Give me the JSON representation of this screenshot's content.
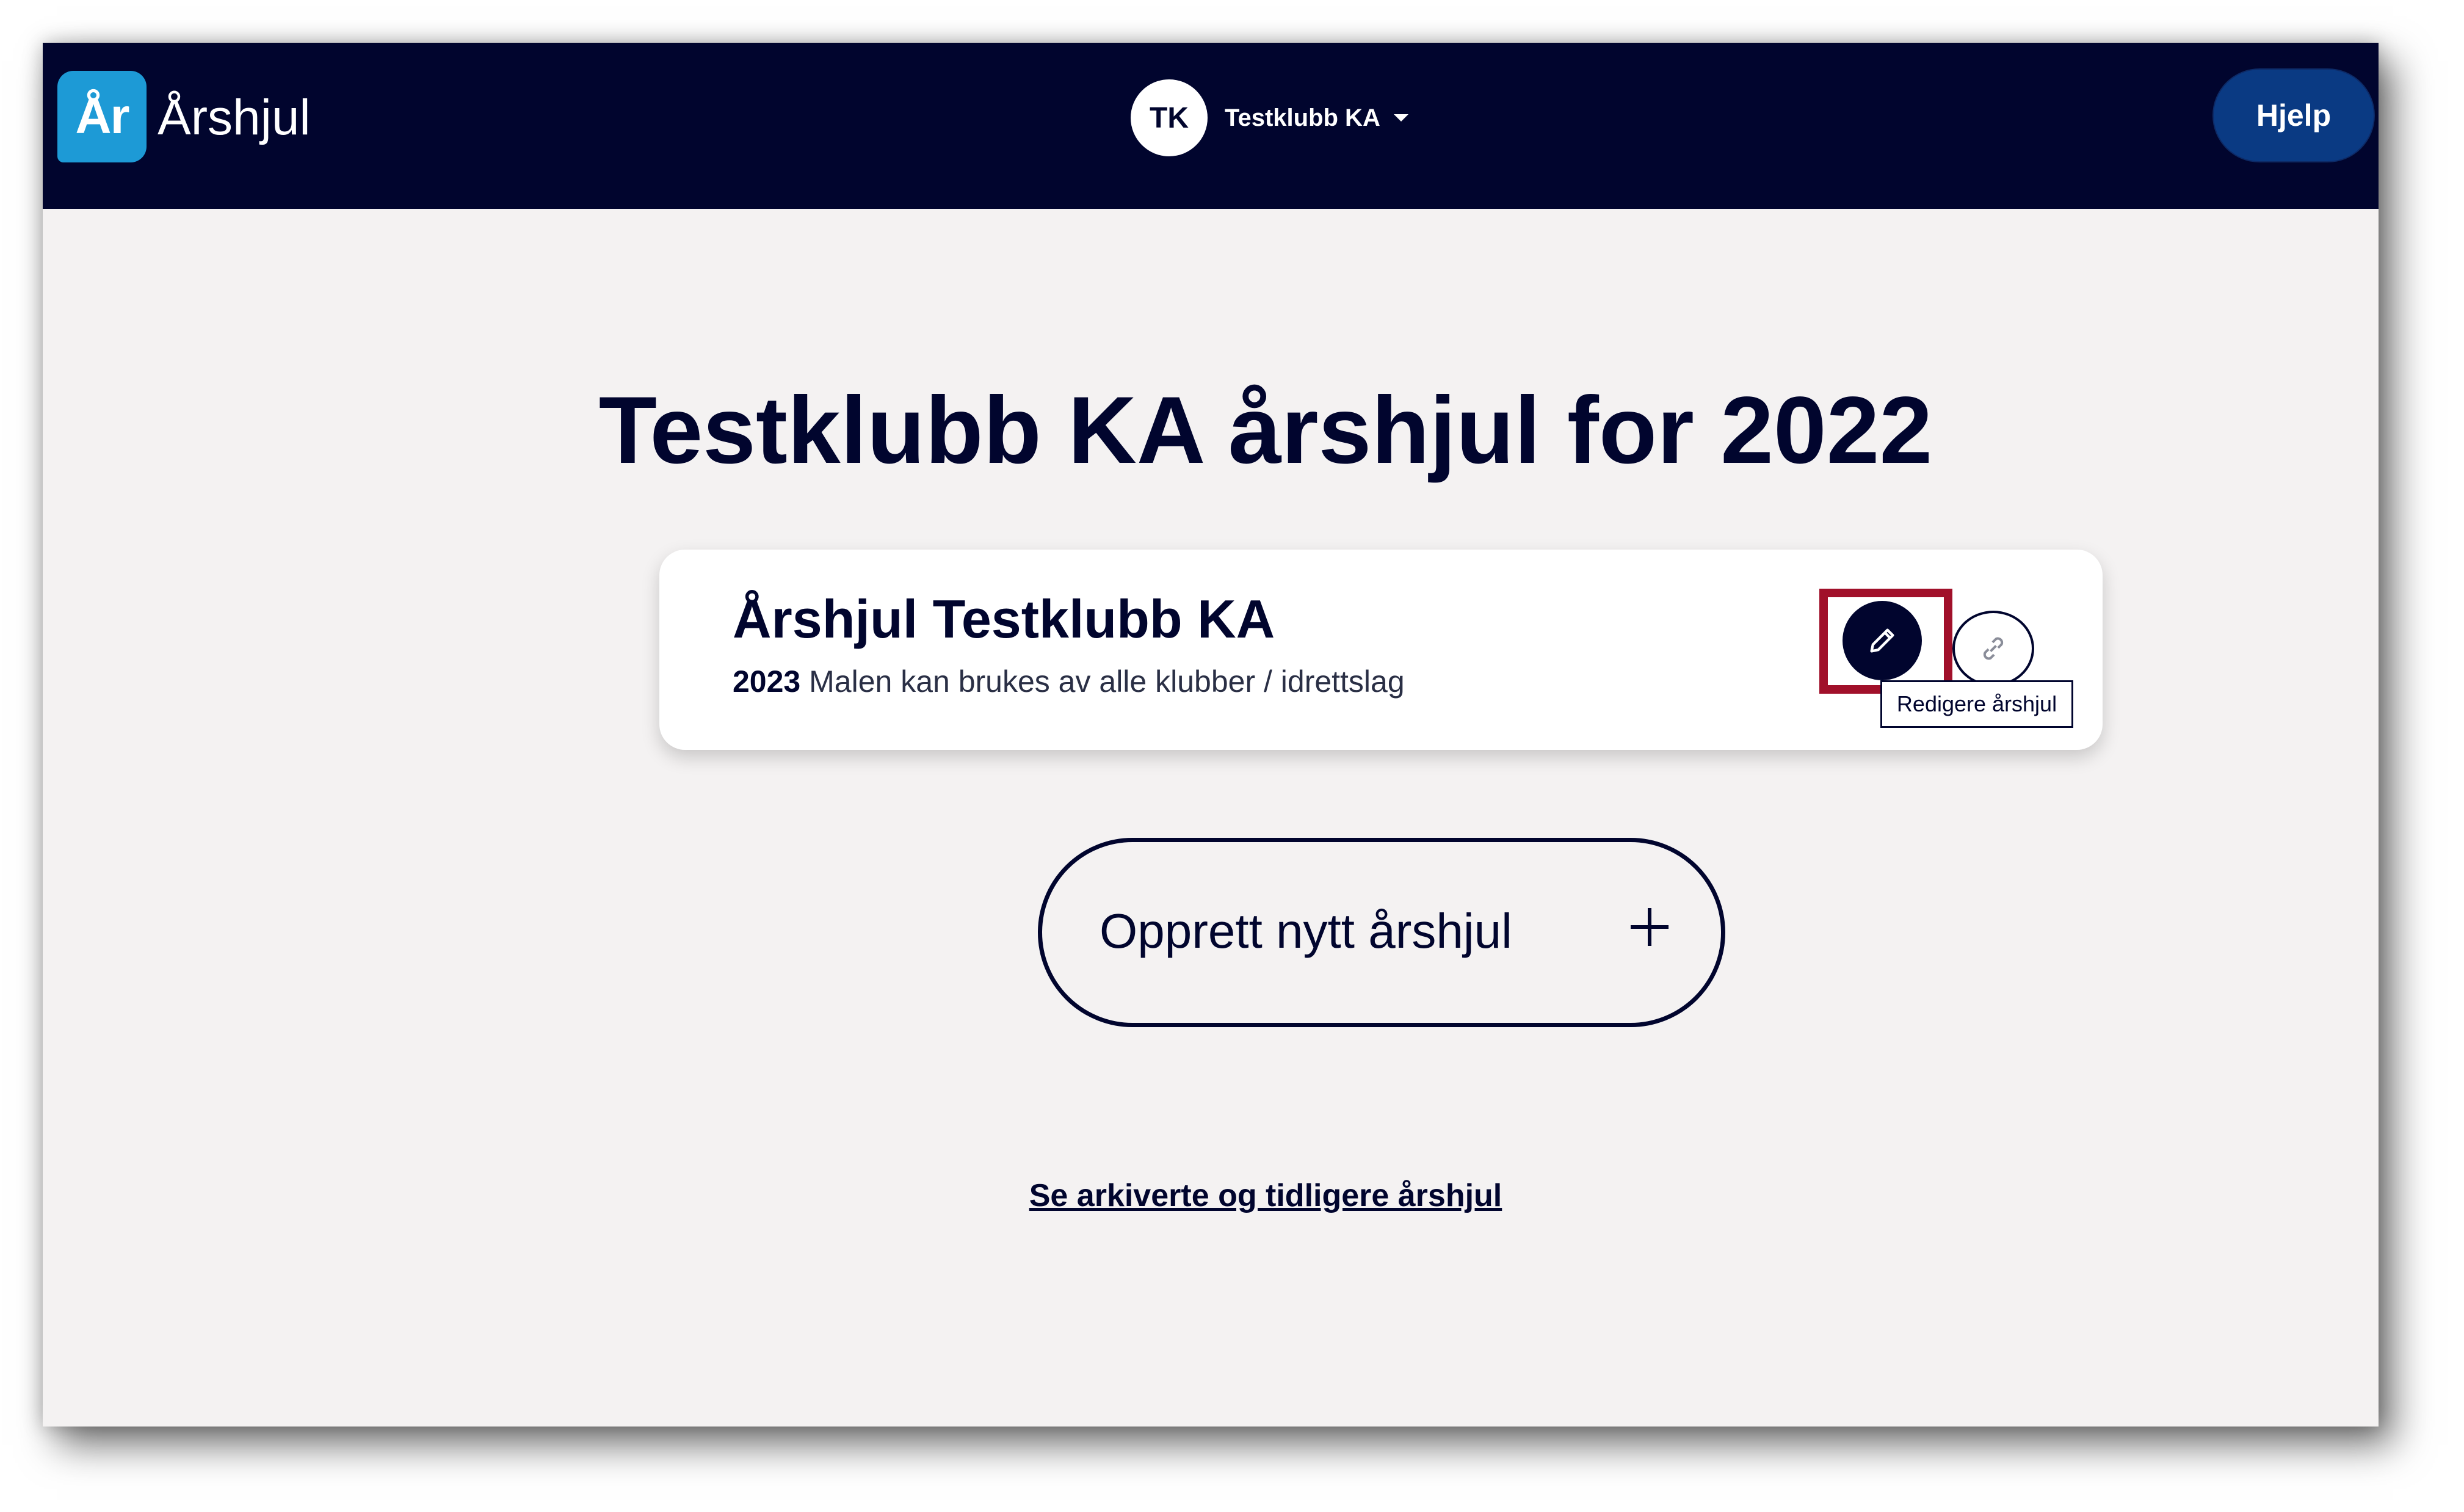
{
  "header": {
    "logo_badge": "År",
    "logo_text": "Årshjul",
    "account": {
      "initials": "TK",
      "name": "Testklubb KA"
    },
    "help_label": "Hjelp"
  },
  "main": {
    "title": "Testklubb KA årshjul for 2022",
    "card": {
      "title": "Årshjul Testklubb KA",
      "year": "2023",
      "description": "Malen kan brukes av alle klubber / idrettslag",
      "edit_icon": "pencil-icon",
      "link_icon": "link-icon",
      "tooltip": "Redigere årshjul"
    },
    "create_button_label": "Opprett nytt årshjul",
    "create_icon": "plus-icon",
    "archive_link": "Se arkiverte og tidligere årshjul"
  },
  "colors": {
    "header_bg": "#01052e",
    "logo_accent": "#1d9ad6",
    "help_button": "#0a3a83",
    "page_bg": "#f4f2f2",
    "highlight": "#a1102a"
  }
}
